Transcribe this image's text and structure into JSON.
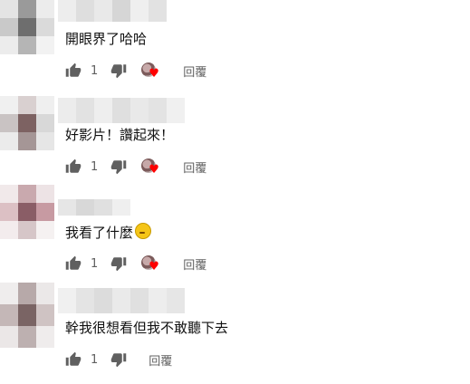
{
  "comments": [
    {
      "text": "開眼界了哈哈",
      "likes": "1",
      "reply_label": "回覆",
      "has_emoji": false,
      "creator_heart": true
    },
    {
      "text": "好影片！讚起來！",
      "likes": "1",
      "reply_label": "回覆",
      "has_emoji": false,
      "creator_heart": true
    },
    {
      "text": "我看了什麼",
      "likes": "1",
      "reply_label": "回覆",
      "has_emoji": true,
      "emoji": "thinking-face-icon",
      "creator_heart": true
    },
    {
      "text": "幹我很想看但我不敢聽下去",
      "likes": "1",
      "reply_label": "回覆",
      "has_emoji": false,
      "creator_heart": false
    }
  ],
  "colors": {
    "heart": "#ff0000",
    "icon_gray": "#606060",
    "text": "#111111"
  },
  "icons": {
    "like": "thumb-up-icon",
    "dislike": "thumb-down-icon",
    "creator_heart": "creator-heart-badge"
  }
}
